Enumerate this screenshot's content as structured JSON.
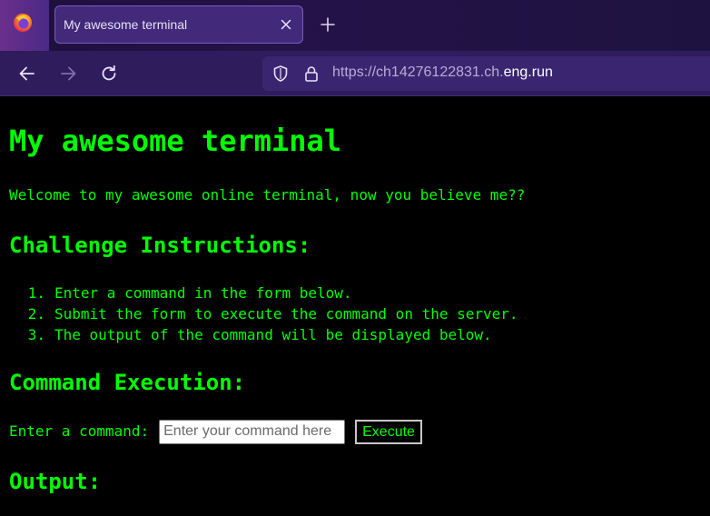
{
  "browser": {
    "tab": {
      "title": "My awesome terminal"
    },
    "url": {
      "prefix": "https://ch14276122831.ch.",
      "host": "eng.run"
    },
    "colors": {
      "chrome_dark": "#1f0f3e",
      "toolbar": "#2e1c5c",
      "accent": "#7a5bc2"
    },
    "icons": [
      "firefox-logo-icon",
      "close-icon",
      "plus-icon",
      "back-arrow-icon",
      "forward-arrow-icon",
      "reload-icon",
      "shield-icon",
      "lock-icon"
    ]
  },
  "page": {
    "title": "My awesome terminal",
    "welcome": "Welcome to my awesome online terminal, now you believe me??",
    "instructions_heading": "Challenge Instructions:",
    "instructions": [
      {
        "num": "1.",
        "text": "Enter a command in the form below."
      },
      {
        "num": "2.",
        "text": "Submit the form to execute the command on the server."
      },
      {
        "num": "3.",
        "text": "The output of the command will be displayed below."
      }
    ],
    "execution_heading": "Command Execution:",
    "form": {
      "label": "Enter a command:",
      "placeholder": "Enter your command here",
      "value": "",
      "button": "Execute"
    },
    "output_heading": "Output:",
    "colors": {
      "background": "#000000",
      "text": "#00ff00"
    }
  }
}
